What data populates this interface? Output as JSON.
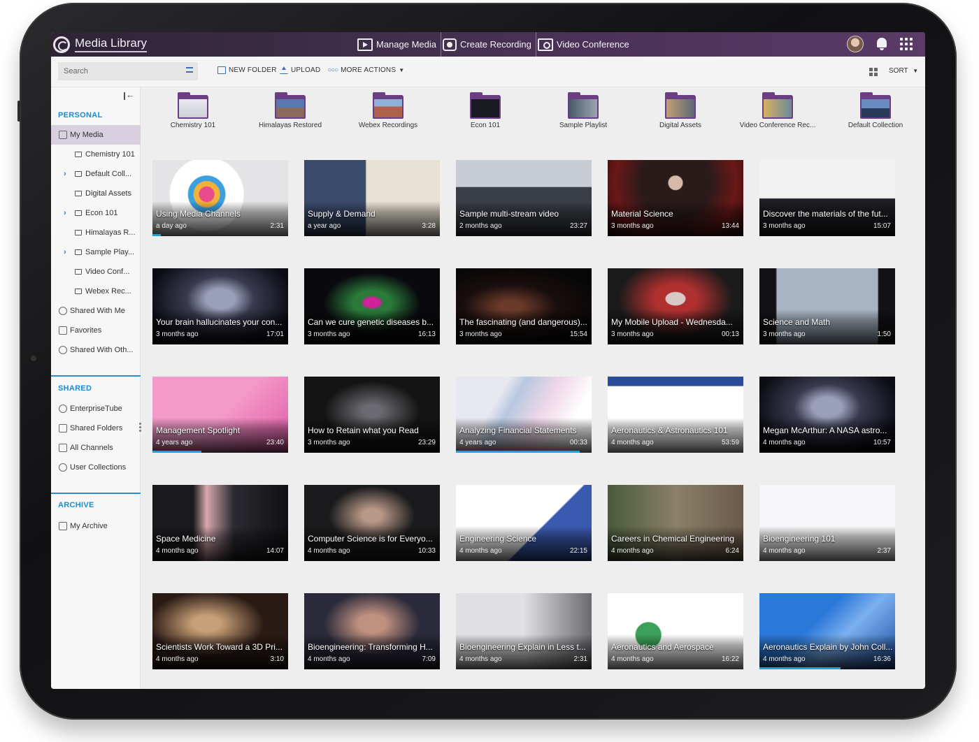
{
  "app": {
    "title": "Media Library"
  },
  "nav": [
    {
      "label": "Manage Media",
      "icon": "play-square-icon"
    },
    {
      "label": "Create Recording",
      "icon": "camera-icon"
    },
    {
      "label": "Video Conference",
      "icon": "conference-icon"
    }
  ],
  "toolbar": {
    "search_placeholder": "Search",
    "new_folder": "NEW FOLDER",
    "upload": "UPLOAD",
    "more_actions": "MORE ACTIONS",
    "sort": "SORT"
  },
  "sidebar": {
    "personal_title": "PERSONAL",
    "shared_title": "SHARED",
    "archive_title": "ARCHIVE",
    "personal_items": [
      {
        "label": "My Media",
        "active": true,
        "icon": "home-icon"
      },
      {
        "label": "Chemistry 101",
        "folder": true,
        "expandable": false
      },
      {
        "label": "Default Coll...",
        "folder": true,
        "expandable": true
      },
      {
        "label": "Digital Assets",
        "folder": true,
        "expandable": false
      },
      {
        "label": "Econ 101",
        "folder": true,
        "expandable": true
      },
      {
        "label": "Himalayas R...",
        "folder": true,
        "expandable": false
      },
      {
        "label": "Sample Play...",
        "folder": true,
        "expandable": true
      },
      {
        "label": "Video Conf...",
        "folder": true,
        "expandable": false
      },
      {
        "label": "Webex Rec...",
        "folder": true,
        "expandable": false
      },
      {
        "label": "Shared With Me",
        "icon": "share-icon"
      },
      {
        "label": "Favorites",
        "icon": "star-icon"
      },
      {
        "label": "Shared With Oth...",
        "icon": "share-out-icon"
      }
    ],
    "shared_items": [
      {
        "label": "EnterpriseTube",
        "icon": "globe-icon"
      },
      {
        "label": "Shared Folders",
        "icon": "shared-folder-icon"
      },
      {
        "label": "All Channels",
        "icon": "channels-icon"
      },
      {
        "label": "User Collections",
        "icon": "user-collection-icon"
      }
    ],
    "archive_items": [
      {
        "label": "My Archive",
        "icon": "archive-icon"
      }
    ]
  },
  "folders": [
    {
      "name": "Chemistry 101"
    },
    {
      "name": "Himalayas Restored"
    },
    {
      "name": "Webex Recordings"
    },
    {
      "name": "Econ 101"
    },
    {
      "name": "Sample Playlist"
    },
    {
      "name": "Digital Assets"
    },
    {
      "name": "Video Conference Rec..."
    },
    {
      "name": "Default Collection"
    }
  ],
  "media": [
    {
      "title": "Using Media Channels",
      "age": "a day ago",
      "duration": "2:31",
      "progress": 0.06
    },
    {
      "title": "Supply & Demand",
      "age": "a year ago",
      "duration": "3:28",
      "progress": 0
    },
    {
      "title": "Sample multi-stream video",
      "age": "2 months ago",
      "duration": "23:27",
      "progress": 0
    },
    {
      "title": "Material Science",
      "age": "3 months ago",
      "duration": "13:44",
      "progress": 0
    },
    {
      "title": "Discover the materials of the fut...",
      "age": "3 months ago",
      "duration": "15:07",
      "progress": 0
    },
    {
      "title": "Your brain hallucinates your con...",
      "age": "3 months ago",
      "duration": "17:01",
      "progress": 0
    },
    {
      "title": "Can we cure genetic diseases b...",
      "age": "3 months ago",
      "duration": "16:13",
      "progress": 0
    },
    {
      "title": "The fascinating (and dangerous)...",
      "age": "3 months ago",
      "duration": "15:54",
      "progress": 0
    },
    {
      "title": "My Mobile Upload - Wednesda...",
      "age": "3 months ago",
      "duration": "00:13",
      "progress": 0
    },
    {
      "title": "Science and Math",
      "age": "3 months ago",
      "duration": "1:50",
      "progress": 0
    },
    {
      "title": "Management Spotlight",
      "age": "4 years ago",
      "duration": "23:40",
      "progress": 0.36
    },
    {
      "title": "How to Retain what you Read",
      "age": "3 months ago",
      "duration": "23:29",
      "progress": 0
    },
    {
      "title": "Analyzing Financial Statements",
      "age": "4 years ago",
      "duration": "00:33",
      "progress": 0.91
    },
    {
      "title": "Aeronautics & Astronautics 101",
      "age": "4 months ago",
      "duration": "53:59",
      "progress": 0
    },
    {
      "title": "Megan McArthur: A NASA astro...",
      "age": "4 months ago",
      "duration": "10:57",
      "progress": 0
    },
    {
      "title": "Space Medicine",
      "age": "4 months ago",
      "duration": "14:07",
      "progress": 0
    },
    {
      "title": "Computer Science is for Everyo...",
      "age": "4 months ago",
      "duration": "10:33",
      "progress": 0
    },
    {
      "title": "Engineering Science",
      "age": "4 months ago",
      "duration": "22:15",
      "progress": 0
    },
    {
      "title": "Careers in Chemical Engineering",
      "age": "4 months ago",
      "duration": "6:24",
      "progress": 0
    },
    {
      "title": "Bioengineering 101",
      "age": "4 months ago",
      "duration": "2:37",
      "progress": 0
    },
    {
      "title": "Scientists Work Toward a 3D Pri...",
      "age": "4 months ago",
      "duration": "3:10",
      "progress": 0
    },
    {
      "title": "Bioengineering: Transforming H...",
      "age": "4 months ago",
      "duration": "7:09",
      "progress": 0
    },
    {
      "title": "Bioengineering Explain in Less t...",
      "age": "4 months ago",
      "duration": "2:31",
      "progress": 0
    },
    {
      "title": "Aeronautics and Aerospace",
      "age": "4 months ago",
      "duration": "16:22",
      "progress": 0
    },
    {
      "title": "Aeronautics Explain by John Coll...",
      "age": "4 months ago",
      "duration": "16:36",
      "progress": 0.6
    }
  ]
}
